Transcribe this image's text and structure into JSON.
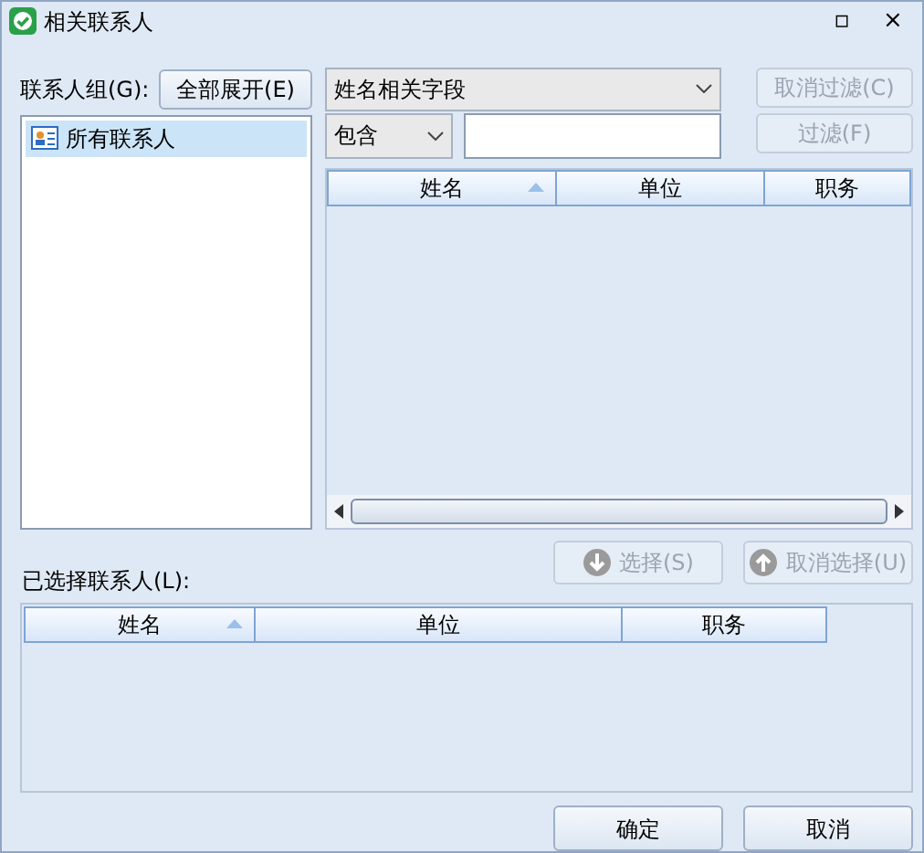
{
  "window": {
    "title": "相关联系人",
    "buttons": [
      "▫",
      "×"
    ]
  },
  "group_label": "联系人组(G):",
  "expand_button": {
    "label": "全部展开(E)",
    "disabled": false
  },
  "tree": {
    "items": [
      {
        "label": "所有联系人",
        "selected": true
      }
    ]
  },
  "field_select": {
    "value": "姓名相关字段"
  },
  "cancel_filter_button": {
    "label": "取消过滤(C)",
    "disabled": true
  },
  "match_select": {
    "value": "包含"
  },
  "filter_button": {
    "label": "过滤(F)",
    "disabled": true
  },
  "contacts_table": {
    "columns": [
      {
        "label": "姓名",
        "sorted": true
      },
      {
        "label": "单位",
        "sorted": false
      },
      {
        "label": "职务",
        "sorted": false
      }
    ]
  },
  "select_button": {
    "label": "选择(S)",
    "disabled": true
  },
  "deselect_button": {
    "label": "取消选择(U)",
    "disabled": true
  },
  "selected_label": "已选择联系人(L):",
  "selected_table": {
    "columns": [
      {
        "label": "姓名",
        "sorted": true
      },
      {
        "label": "单位",
        "sorted": false
      },
      {
        "label": "职务",
        "sorted": false
      }
    ]
  },
  "ok_button": {
    "label": "确定",
    "disabled": false
  },
  "cancel_button": {
    "label": "取消",
    "disabled": false
  }
}
